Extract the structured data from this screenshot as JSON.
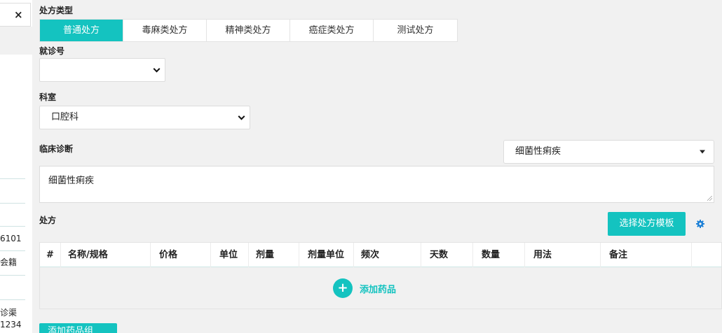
{
  "left_panel": {
    "close_symbol": "×",
    "snippets": [
      "6101",
      "会籍",
      "诊渠",
      "1234"
    ]
  },
  "prescription_type": {
    "label": "处方类型",
    "tabs": [
      {
        "label": "普通处方",
        "active": true
      },
      {
        "label": "毒麻类处方",
        "active": false
      },
      {
        "label": "精神类处方",
        "active": false
      },
      {
        "label": "癌症类处方",
        "active": false
      },
      {
        "label": "测试处方",
        "active": false
      }
    ]
  },
  "visit_no": {
    "label": "就诊号",
    "value": ""
  },
  "department": {
    "label": "科室",
    "value": "口腔科"
  },
  "diagnosis": {
    "label": "临床诊断",
    "select_value": "细菌性痢疾",
    "text_value": "细菌性痢疾"
  },
  "prescription": {
    "label": "处方",
    "template_button": "选择处方模板",
    "gear_icon": "gear-icon",
    "columns": [
      "#",
      "名称/规格",
      "价格",
      "单位",
      "剂量",
      "剂量单位",
      "频次",
      "天数",
      "数量",
      "用法",
      "备注"
    ],
    "add_drug": "添加药品",
    "add_group_partial": "添加药品组"
  },
  "colors": {
    "accent": "#14c3c0",
    "background": "#f1f1f1"
  }
}
